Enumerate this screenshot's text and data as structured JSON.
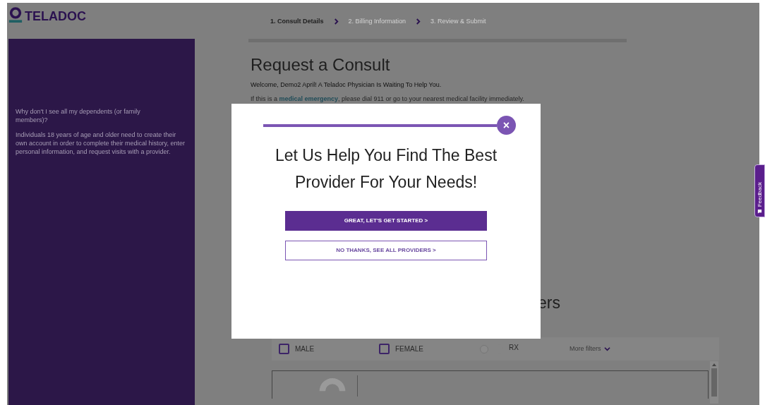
{
  "header": {
    "logo": "TELADOC"
  },
  "steps": [
    {
      "label": "1. Consult Details",
      "selected": true
    },
    {
      "label": "2. Billing Information",
      "selected": false
    },
    {
      "label": "3. Review & Submit",
      "selected": false
    }
  ],
  "sidebar": {
    "question": "Why don't I see all my dependents (or family members)?",
    "answer": "Individuals 18 years of age and older need to create their own account in order to complete their medical history, enter personal information, and request visits with a provider."
  },
  "main": {
    "title": "Request a Consult",
    "welcome": "Welcome, Demo2 April! A Teladoc Physician Is Waiting To Help You.",
    "emergency": "If this is a **medical emergency**, please dial 911 or go to your nearest medical facility immediately.",
    "section_title_fragment": "ers"
  },
  "filters": [
    {
      "kind": "checkbox",
      "label": "MALE",
      "checked": false
    },
    {
      "kind": "checkbox",
      "label": "FEMALE",
      "checked": false
    },
    {
      "kind": "toggle",
      "label": "RX",
      "on": false
    },
    {
      "kind": "dropdown",
      "label": "More filters"
    }
  ],
  "modal": {
    "close": "×",
    "heading": "Let Us Help You Find The Best Provider For Your Needs!",
    "buttons": [
      {
        "label": "GREAT, LET'S GET STARTED >",
        "kind": "primary"
      },
      {
        "label": "NO THANKS, SEE ALL PROVIDERS >",
        "kind": "secondary"
      }
    ]
  },
  "feedback": "Feedback"
}
